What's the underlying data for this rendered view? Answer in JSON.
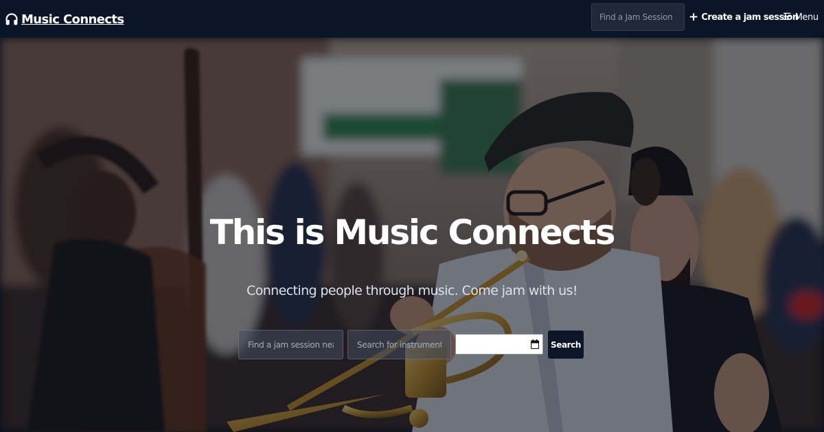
{
  "navbar": {
    "brand_name": "Music Connects",
    "brand_icon": "headphones-icon",
    "search_placeholder": "Find a Jam Session",
    "create_label": "Create a jam session",
    "create_icon": "plus-icon",
    "menu_label": "Menu",
    "menu_icon": "hamburger-icon",
    "background_color": "#0b1528"
  },
  "hero": {
    "title": "This is Music Connects",
    "subtitle": "Connecting people through music. Come jam with us!",
    "search": {
      "location_placeholder": "Find a jam session near",
      "instrument_placeholder": "Search for instrument...",
      "date_value": "",
      "button_label": "Search"
    }
  },
  "colors": {
    "accent": "#0d1629",
    "text": "#ffffff"
  }
}
